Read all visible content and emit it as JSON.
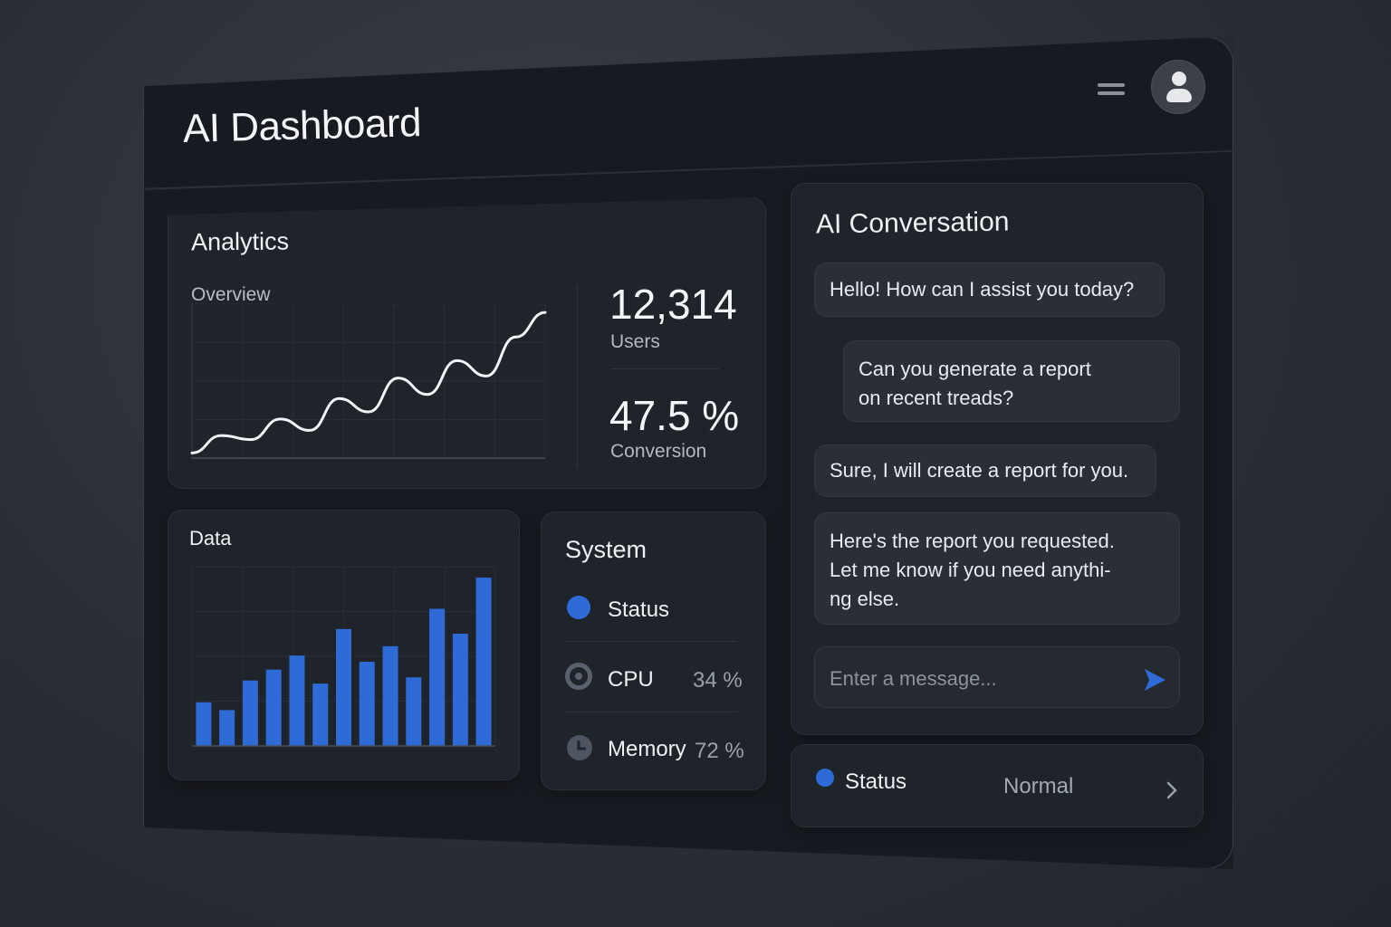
{
  "app": {
    "title": "AI Dashboard"
  },
  "header": {
    "menu_icon": "hamburger-menu-icon",
    "avatar_icon": "user-avatar-icon"
  },
  "analytics": {
    "title": "Analytics",
    "subtitle": "Overview",
    "stats": [
      {
        "value": "12,314",
        "label": "Users"
      },
      {
        "value": "47.5 %",
        "label": "Conversion"
      }
    ]
  },
  "data": {
    "title": "Data"
  },
  "system": {
    "title": "System",
    "rows": [
      {
        "label": "Status",
        "value": "",
        "icon": "status-dot-icon"
      },
      {
        "label": "CPU",
        "value": "34 %",
        "icon": "cpu-ring-icon"
      },
      {
        "label": "Memory",
        "value": "72 %",
        "icon": "memory-clock-icon"
      }
    ]
  },
  "conversation": {
    "title": "AI Conversation",
    "messages": [
      {
        "sender": "ai",
        "text": "Hello! How can I assist you today?"
      },
      {
        "sender": "user",
        "text": "Can you generate a report on recent treads?"
      },
      {
        "sender": "ai",
        "text": "Sure, I will create a report for you."
      },
      {
        "sender": "ai",
        "text": "Here's the report you requested. Let me know if you need anythi- ng else."
      }
    ],
    "input_placeholder": "Enter a message...",
    "send_icon": "send-arrow-icon"
  },
  "status_bar": {
    "label": "Status",
    "value": "Normal",
    "icon": "chevron-right-icon"
  },
  "colors": {
    "accent": "#2f6bd6",
    "background": "#171a20",
    "card": "#1f232a"
  },
  "chart_data": [
    {
      "type": "line",
      "title": "Overview",
      "x": [
        0,
        1,
        2,
        3,
        4,
        5,
        6,
        7,
        8,
        9,
        10,
        11,
        12
      ],
      "series": [
        {
          "values": [
            5,
            22,
            18,
            38,
            27,
            58,
            45,
            78,
            62,
            95,
            80,
            118,
            142
          ]
        }
      ],
      "ylim": [
        0,
        150
      ],
      "grid": true
    },
    {
      "type": "bar",
      "title": "Data",
      "categories": [
        "1",
        "2",
        "3",
        "4",
        "5",
        "6",
        "7",
        "8",
        "9",
        "10",
        "11",
        "12",
        "13"
      ],
      "values": [
        28,
        23,
        42,
        49,
        58,
        40,
        75,
        54,
        64,
        44,
        88,
        72,
        108
      ],
      "ylim": [
        0,
        115
      ],
      "grid": true
    }
  ]
}
